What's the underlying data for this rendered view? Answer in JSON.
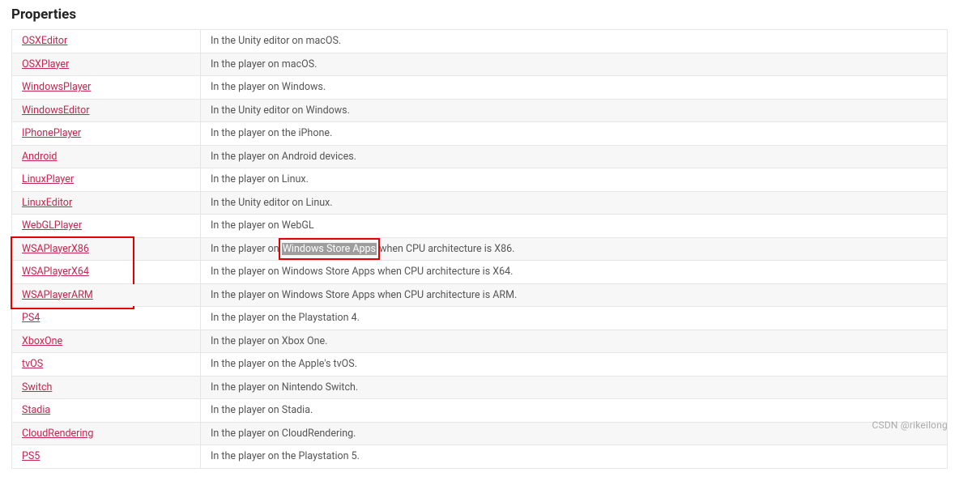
{
  "heading": "Properties",
  "highlight_text": "Windows Store Apps",
  "watermark": "CSDN @rikeilong",
  "rows": [
    {
      "name": "OSXEditor",
      "desc": "In the Unity editor on macOS."
    },
    {
      "name": "OSXPlayer",
      "desc": "In the player on macOS."
    },
    {
      "name": "WindowsPlayer",
      "desc": "In the player on Windows."
    },
    {
      "name": "WindowsEditor",
      "desc": "In the Unity editor on Windows."
    },
    {
      "name": "IPhonePlayer",
      "desc": "In the player on the iPhone."
    },
    {
      "name": "Android",
      "desc": "In the player on Android devices."
    },
    {
      "name": "LinuxPlayer",
      "desc": "In the player on Linux."
    },
    {
      "name": "LinuxEditor",
      "desc": "In the Unity editor on Linux."
    },
    {
      "name": "WebGLPlayer",
      "desc": "In the player on WebGL"
    },
    {
      "name": "WSAPlayerX86",
      "desc_pre": "In the player on ",
      "desc_post": " when CPU architecture is X86.",
      "highlight_wsa": true,
      "red_name": true,
      "red_desc": true
    },
    {
      "name": "WSAPlayerX64",
      "desc": "In the player on Windows Store Apps when CPU architecture is X64.",
      "red_name": true
    },
    {
      "name": "WSAPlayerARM",
      "desc": "In the player on Windows Store Apps when CPU architecture is ARM.",
      "red_name": true
    },
    {
      "name": "PS4",
      "desc": "In the player on the Playstation 4."
    },
    {
      "name": "XboxOne",
      "desc": "In the player on Xbox One."
    },
    {
      "name": "tvOS",
      "desc": "In the player on the Apple's tvOS."
    },
    {
      "name": "Switch",
      "desc": "In the player on Nintendo Switch."
    },
    {
      "name": "Stadia",
      "desc": "In the player on Stadia."
    },
    {
      "name": "CloudRendering",
      "desc": "In the player on CloudRendering."
    },
    {
      "name": "PS5",
      "desc": "In the player on the Playstation 5."
    }
  ]
}
